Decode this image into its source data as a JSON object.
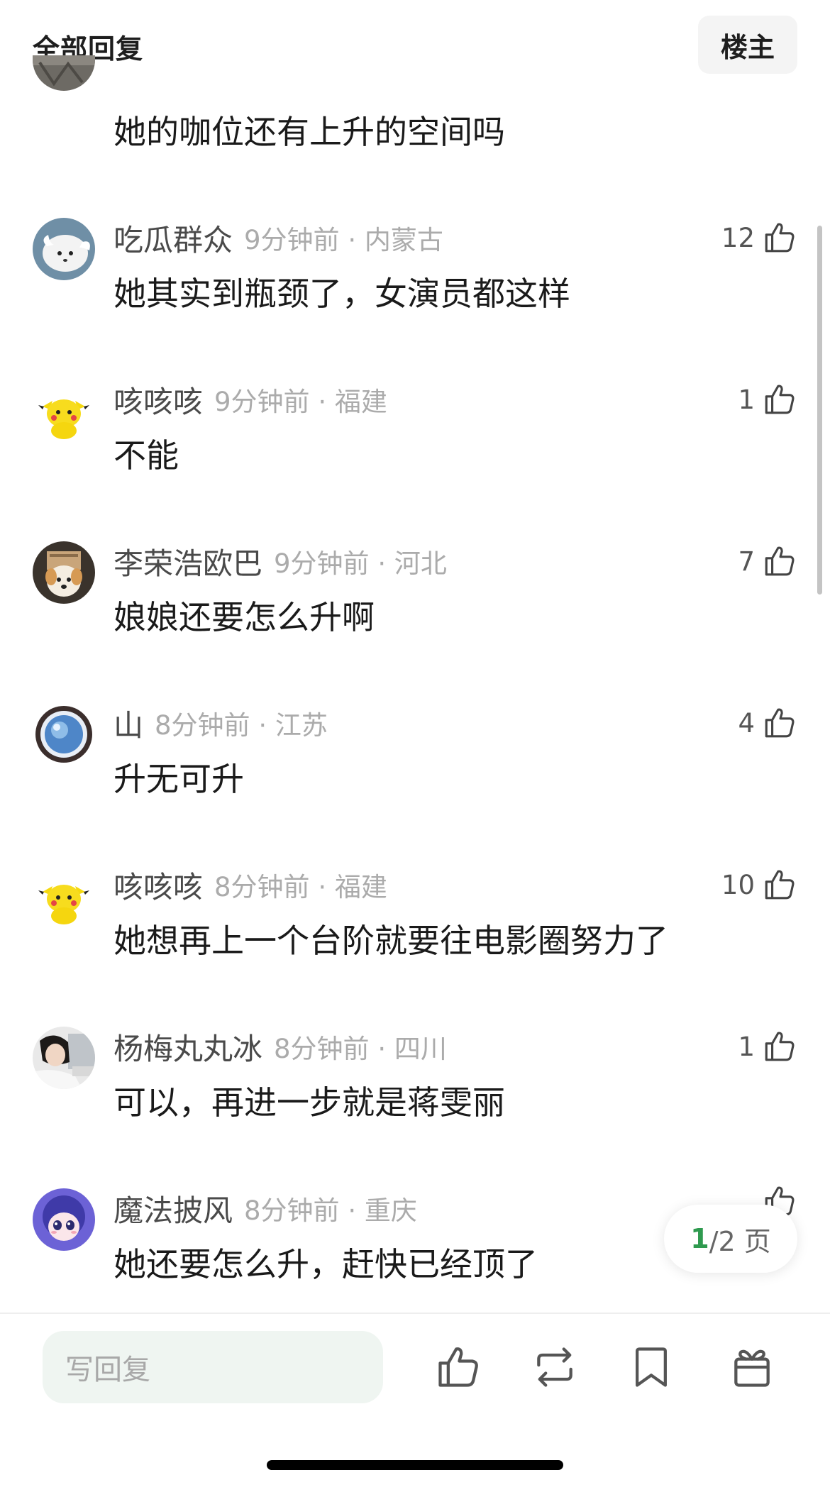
{
  "header": {
    "title": "全部回复",
    "op_button": "楼主"
  },
  "partial_comment": {
    "text": "她的咖位还有上升的空间吗"
  },
  "comments": [
    {
      "username": "吃瓜群众",
      "time_location": "9分钟前 · 内蒙古",
      "text": "她其实到瓶颈了，女演员都这样",
      "likes": "12",
      "avatar": "white-dog-avatar"
    },
    {
      "username": "咳咳咳",
      "time_location": "9分钟前 · 福建",
      "text": "不能",
      "likes": "1",
      "avatar": "pikachu-avatar"
    },
    {
      "username": "李荣浩欧巴",
      "time_location": "9分钟前 · 河北",
      "text": "娘娘还要怎么升啊",
      "likes": "7",
      "avatar": "box-dog-avatar"
    },
    {
      "username": "山",
      "time_location": "8分钟前 · 江苏",
      "text": "升无可升",
      "likes": "4",
      "avatar": "blue-orb-avatar"
    },
    {
      "username": "咳咳咳",
      "time_location": "8分钟前 · 福建",
      "text": "她想再上一个台阶就要往电影圈努力了",
      "likes": "10",
      "avatar": "pikachu-avatar"
    },
    {
      "username": "杨梅丸丸冰",
      "time_location": "8分钟前 · 四川",
      "text": "可以，再进一步就是蒋雯丽",
      "likes": "1",
      "avatar": "girl-photo-avatar"
    },
    {
      "username": "魔法披风",
      "time_location": "8分钟前 · 重庆",
      "text": "她还要怎么升，赶快已经顶了",
      "likes": "",
      "avatar": "anime-girl-avatar"
    }
  ],
  "pagination": {
    "current": "1",
    "rest": "/2 页"
  },
  "bottom_bar": {
    "reply_placeholder": "写回复",
    "icons": [
      "thumbs-up-icon",
      "repost-icon",
      "bookmark-icon",
      "gift-icon"
    ]
  },
  "colors": {
    "accent_green": "#2f9a4f",
    "reply_bg": "#eff5f1",
    "meta_gray": "#ababab"
  }
}
